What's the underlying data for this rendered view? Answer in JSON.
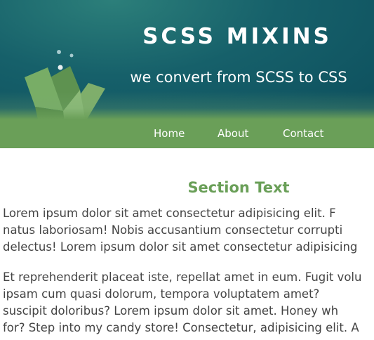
{
  "header": {
    "title": "SCSS MIXINS",
    "tagline": "we convert from SCSS to CSS"
  },
  "nav": {
    "items": [
      {
        "label": "Home"
      },
      {
        "label": "About"
      },
      {
        "label": "Contact"
      }
    ]
  },
  "main": {
    "section_title": "Section Text",
    "paragraphs": [
      {
        "lines": [
          "Lorem ipsum dolor sit amet consectetur adipisicing elit. F",
          "natus laboriosam! Nobis accusantium consectetur corrupti",
          "delectus! Lorem ipsum dolor sit amet consectetur adipisicing"
        ]
      },
      {
        "lines": [
          "Et reprehenderit placeat iste, repellat amet in eum. Fugit volu",
          "ipsam cum quasi dolorum, tempora voluptatem amet?",
          "suscipit doloribus? Lorem ipsum dolor sit amet. Honey wh",
          "for? Step into my candy store! Consectetur, adipisicing elit. A"
        ]
      }
    ]
  },
  "colors": {
    "accent_green": "#6a9f58",
    "hero_teal": "#16606a",
    "text": "#444444"
  },
  "icons": {
    "logo": "open-book-icon"
  }
}
